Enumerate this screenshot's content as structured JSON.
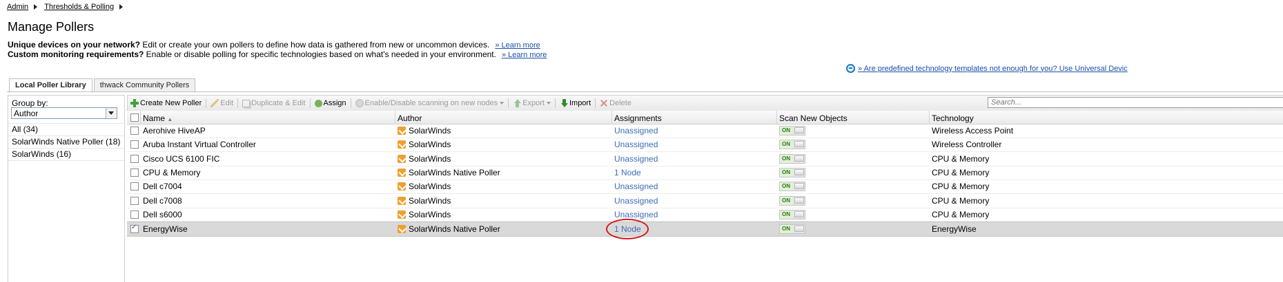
{
  "breadcrumb": {
    "items": [
      "Admin",
      "Thresholds & Polling"
    ]
  },
  "page": {
    "title": "Manage Pollers",
    "desc1_bold": "Unique devices on your network?",
    "desc1_text": " Edit or create your own pollers to define how data is gathered from new or uncommon devices.",
    "desc1_link": "» Learn more",
    "desc2_bold": "Custom monitoring requirements?",
    "desc2_text": " Enable or disable polling for specific technologies based on what's needed in your environment.",
    "desc2_link": "» Learn more",
    "ut_link": "» Are predefined technology templates not enough for you? Use Universal Devic"
  },
  "tabs": [
    "Local Poller Library",
    "thwack Community Pollers"
  ],
  "group_by": {
    "label": "Group by:",
    "selected": "Author",
    "items": [
      "All (34)",
      "SolarWinds Native Poller (18)",
      "SolarWinds (16)"
    ]
  },
  "toolbar": {
    "create": "Create New Poller",
    "edit": "Edit",
    "duplicate": "Duplicate & Edit",
    "assign": "Assign",
    "scan": "Enable/Disable scanning on new nodes",
    "export": "Export",
    "import": "Import",
    "delete": "Delete",
    "search_placeholder": "Search..."
  },
  "columns": [
    "Name",
    "Author",
    "Assignments",
    "Scan New Objects",
    "Technology"
  ],
  "rows": [
    {
      "name": "Aerohive HiveAP",
      "author": "SolarWinds",
      "assign": "Unassigned",
      "scan": "ON",
      "tech": "Wireless Access Point",
      "checked": false
    },
    {
      "name": "Aruba Instant Virtual Controller",
      "author": "SolarWinds",
      "assign": "Unassigned",
      "scan": "ON",
      "tech": "Wireless Controller",
      "checked": false
    },
    {
      "name": "Cisco UCS 6100 FIC",
      "author": "SolarWinds",
      "assign": "Unassigned",
      "scan": "ON",
      "tech": "CPU & Memory",
      "checked": false
    },
    {
      "name": "CPU & Memory",
      "author": "SolarWinds Native Poller",
      "assign": "1 Node",
      "scan": "ON",
      "tech": "CPU & Memory",
      "checked": false
    },
    {
      "name": "Dell c7004",
      "author": "SolarWinds",
      "assign": "Unassigned",
      "scan": "ON",
      "tech": "CPU & Memory",
      "checked": false
    },
    {
      "name": "Dell c7008",
      "author": "SolarWinds",
      "assign": "Unassigned",
      "scan": "ON",
      "tech": "CPU & Memory",
      "checked": false
    },
    {
      "name": "Dell s6000",
      "author": "SolarWinds",
      "assign": "Unassigned",
      "scan": "ON",
      "tech": "CPU & Memory",
      "checked": false
    },
    {
      "name": "EnergyWise",
      "author": "SolarWinds Native Poller",
      "assign": "1 Node",
      "scan": "ON",
      "tech": "EnergyWise",
      "checked": true
    }
  ]
}
